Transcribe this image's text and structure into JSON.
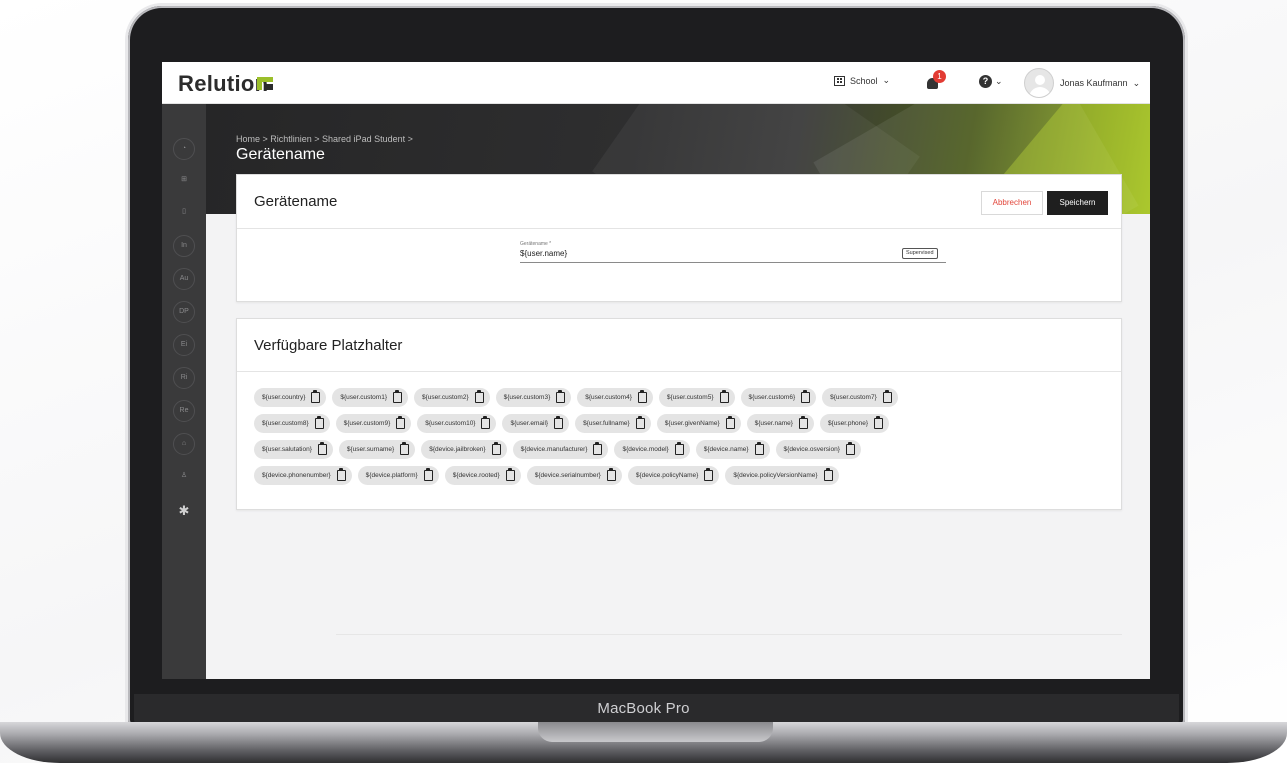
{
  "device_label": "MacBook Pro",
  "app": {
    "name": "Relution"
  },
  "topbar": {
    "organization": "School",
    "notification_count": "1",
    "help_icon": "?",
    "user_name": "Jonas Kaufmann"
  },
  "sidebar": {
    "items": [
      {
        "icon": "dashboard-icon",
        "label": ""
      },
      {
        "icon": "grid-icon",
        "label": ""
      },
      {
        "icon": "device-icon",
        "label": ""
      },
      {
        "icon": "text-icon",
        "label": "In"
      },
      {
        "icon": "text-icon",
        "label": "Au"
      },
      {
        "icon": "text-icon",
        "label": "DP"
      },
      {
        "icon": "text-icon",
        "label": "Ei"
      },
      {
        "icon": "text-icon",
        "label": "Ri"
      },
      {
        "icon": "text-icon",
        "label": "Re"
      },
      {
        "icon": "education-icon",
        "label": ""
      },
      {
        "icon": "user-icon",
        "label": ""
      },
      {
        "icon": "gear-icon",
        "label": "✱"
      }
    ]
  },
  "header": {
    "breadcrumb": "Home > Richtlinien > Shared iPad Student >",
    "title": "Gerätename"
  },
  "settings_card": {
    "title": "Gerätename",
    "cancel_label": "Abbrechen",
    "save_label": "Speichern",
    "field_label": "Gerätename *",
    "field_value": "${user.name}",
    "field_tag": "Supervised"
  },
  "placeholders_card": {
    "title": "Verfügbare Platzhalter",
    "rows": [
      [
        "${user.country}",
        "${user.custom1}",
        "${user.custom2}",
        "${user.custom3}",
        "${user.custom4}",
        "${user.custom5}",
        "${user.custom6}",
        "${user.custom7}"
      ],
      [
        "${user.custom8}",
        "${user.custom9}",
        "${user.custom10}",
        "${user.email}",
        "${user.fullname}",
        "${user.givenName}",
        "${user.name}",
        "${user.phone}"
      ],
      [
        "${user.salutation}",
        "${user.surname}",
        "${device.jailbroken}",
        "${device.manufacturer}",
        "${device.model}",
        "${device.name}",
        "${device.osversion}"
      ],
      [
        "${device.phonenumber}",
        "${device.platform}",
        "${device.rooted}",
        "${device.serialnumber}",
        "${device.policyName}",
        "${device.policyVersionName}"
      ]
    ]
  },
  "colors": {
    "accent": "#9bbf2a",
    "badge": "#e23b33",
    "cancel_text": "#e2463b",
    "save_bg": "#1f1f1f"
  }
}
